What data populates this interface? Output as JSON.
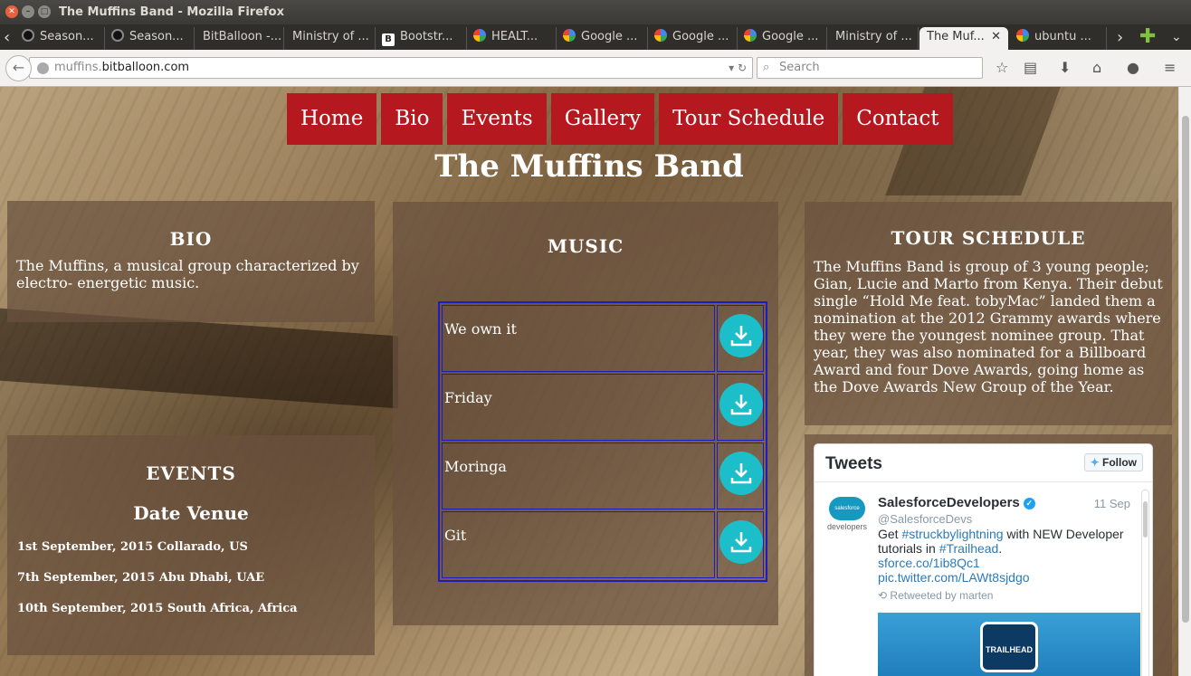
{
  "window": {
    "title": "The Muffins Band - Mozilla Firefox"
  },
  "tabs": [
    {
      "label": "Season...",
      "favicon": "github-icon"
    },
    {
      "label": "Season...",
      "favicon": "github-icon"
    },
    {
      "label": "BitBalloon -...",
      "favicon": "none"
    },
    {
      "label": "Ministry of ...",
      "favicon": "none"
    },
    {
      "label": "Bootstr...",
      "favicon": "bootstrap-icon"
    },
    {
      "label": "HEALT...",
      "favicon": "google-icon"
    },
    {
      "label": "Google ...",
      "favicon": "google-icon"
    },
    {
      "label": "Google ...",
      "favicon": "google-icon"
    },
    {
      "label": "Google ...",
      "favicon": "google-icon"
    },
    {
      "label": "Ministry of ...",
      "favicon": "none"
    },
    {
      "label": "The Muf...",
      "favicon": "none",
      "active": true
    },
    {
      "label": "ubuntu ...",
      "favicon": "google-icon"
    }
  ],
  "navbar": {
    "url_host_prefix": "muffins.",
    "url_host_domain": "bitballoon.com",
    "search_placeholder": "Search"
  },
  "site": {
    "menu": [
      "Home",
      "Bio",
      "Events",
      "Gallery",
      "Tour Schedule",
      "Contact"
    ],
    "title": "The Muffins Band",
    "bio": {
      "heading": "BIO",
      "text": "The Muffins, a musical group characterized by electro- energetic music."
    },
    "events": {
      "heading": "EVENTS",
      "subheading": "Date Venue",
      "items": [
        "1st September, 2015 Collarado, US",
        "7th September, 2015 Abu Dhabi, UAE",
        "10th September, 2015 South Africa, Africa"
      ]
    },
    "music": {
      "heading": "MUSIC",
      "tracks": [
        "We own it",
        "Friday",
        "Moringa",
        "Git"
      ]
    },
    "tour": {
      "heading": "TOUR SCHEDULE",
      "text": "The Muffins Band is group of 3 young people; Gian, Lucie and Marto from Kenya. Their debut single “Hold Me feat. tobyMac” landed them a nomination at the 2012 Grammy awards where they were the youngest nominee group. That year, they was also nominated for a Billboard Award and four Dove Awards, going home as the Dove Awards New Group of the Year."
    },
    "tweets": {
      "title": "Tweets",
      "follow": "Follow",
      "avatar_label": "developers",
      "avatar_logo": "salesforce",
      "name": "SalesforceDevelopers",
      "handle": "@SalesforceDevs",
      "date": "11 Sep",
      "body_1": "Get ",
      "hashtag_1": "#struckbylightning",
      "body_2": " with NEW Developer tutorials in ",
      "hashtag_2": "#Trailhead",
      "body_3": ".",
      "link_1": "sforce.co/1ib8Qc1",
      "link_2": "pic.twitter.com/LAWt8sjdgo",
      "retweeted": "Retweeted by marten",
      "image_badge": "TRAILHEAD"
    }
  }
}
